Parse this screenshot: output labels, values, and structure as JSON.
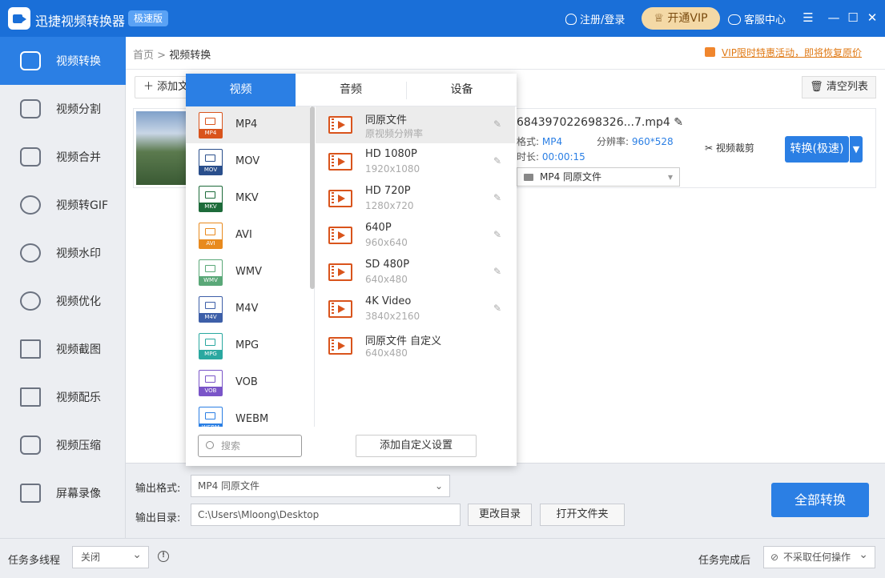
{
  "app": {
    "title": "迅捷视频转换器",
    "edition": "极速版",
    "login": "注册/登录",
    "vip": "开通VIP",
    "service": "客服中心"
  },
  "sidebar": {
    "items": [
      {
        "label": "视频转换",
        "icon": "convert-icon"
      },
      {
        "label": "视频分割",
        "icon": "split-icon"
      },
      {
        "label": "视频合并",
        "icon": "merge-icon"
      },
      {
        "label": "视频转GIF",
        "icon": "gif-icon"
      },
      {
        "label": "视频水印",
        "icon": "watermark-icon"
      },
      {
        "label": "视频优化",
        "icon": "optimize-icon"
      },
      {
        "label": "视频截图",
        "icon": "screenshot-icon"
      },
      {
        "label": "视频配乐",
        "icon": "music-icon"
      },
      {
        "label": "视频压缩",
        "icon": "compress-icon"
      },
      {
        "label": "屏幕录像",
        "icon": "record-icon"
      }
    ]
  },
  "breadcrumb": {
    "home": "首页",
    "sep": ">",
    "current": "视频转换"
  },
  "vip_notice": "VIP限时特惠活动，即将恢复原价",
  "toolbar": {
    "add_file": "添加文",
    "clear_list": "清空列表"
  },
  "file": {
    "name": "684397022698326...7.mp4",
    "format_label": "格式:",
    "format_value": "MP4",
    "resolution_label": "分辨率:",
    "resolution_value": "960*528",
    "duration_label": "时长:",
    "duration_value": "00:00:15",
    "output_select": "MP4  同原文件",
    "crop": "视频裁剪",
    "convert": "转换(极速)"
  },
  "popup": {
    "tabs": [
      "视频",
      "音频",
      "设备"
    ],
    "formats": [
      "MP4",
      "MOV",
      "MKV",
      "AVI",
      "WMV",
      "M4V",
      "MPG",
      "VOB",
      "WEBM"
    ],
    "format_colors": [
      "#d9541c",
      "#2a4f8c",
      "#1d6b3a",
      "#e88a1e",
      "#5aa878",
      "#3d5fa8",
      "#2aa8a0",
      "#7a55c8",
      "#2b7fe4"
    ],
    "search_placeholder": "搜索",
    "resolutions": [
      {
        "name": "同原文件",
        "sub": "原视频分辨率"
      },
      {
        "name": "HD 1080P",
        "sub": "1920x1080"
      },
      {
        "name": "HD 720P",
        "sub": "1280x720"
      },
      {
        "name": "640P",
        "sub": "960x640"
      },
      {
        "name": "SD 480P",
        "sub": "640x480"
      },
      {
        "name": "4K Video",
        "sub": "3840x2160"
      },
      {
        "name": "同原文件 自定义",
        "sub": "640x480"
      }
    ],
    "add_custom": "添加自定义设置"
  },
  "bottom": {
    "output_format_label": "输出格式:",
    "output_format_value": "MP4  同原文件",
    "output_dir_label": "输出目录:",
    "output_dir_value": "C:\\Users\\Mloong\\Desktop",
    "change_dir": "更改目录",
    "open_folder": "打开文件夹",
    "convert_all": "全部转换"
  },
  "status": {
    "multithread_label": "任务多线程",
    "multithread_value": "关闭",
    "after_label": "任务完成后",
    "after_value": "不采取任何操作"
  }
}
